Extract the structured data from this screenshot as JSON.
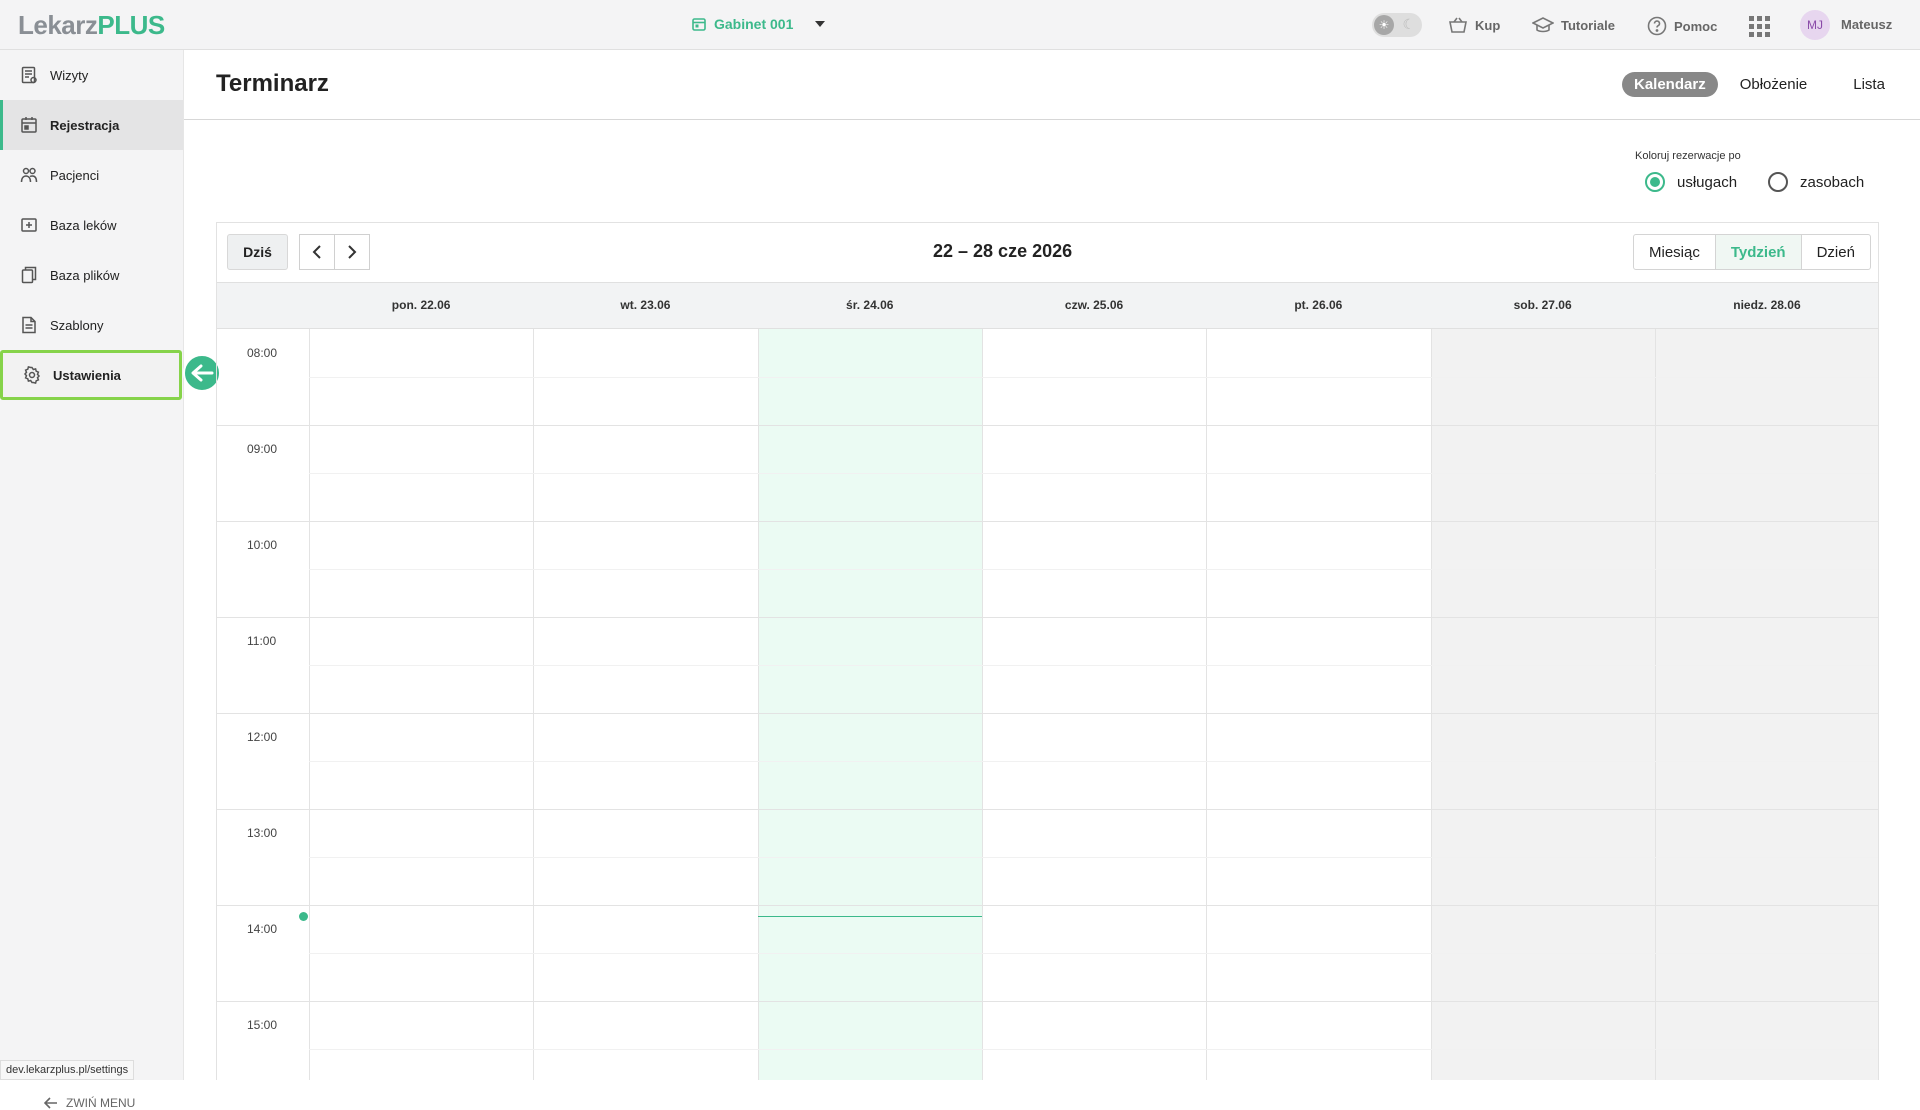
{
  "topbar": {
    "logo_part1": "Lekarz",
    "logo_part2": "PLUS",
    "office": "Gabinet 001",
    "nav": {
      "buy": "Kup",
      "tutorials": "Tutoriale",
      "help": "Pomoc"
    },
    "avatar_initials": "MJ",
    "username": "Mateusz"
  },
  "sidebar": {
    "items": [
      {
        "label": "Wizyty",
        "icon": "visits-icon"
      },
      {
        "label": "Rejestracja",
        "icon": "calendar-icon"
      },
      {
        "label": "Pacjenci",
        "icon": "patients-icon"
      },
      {
        "label": "Baza leków",
        "icon": "medicine-icon"
      },
      {
        "label": "Baza plików",
        "icon": "files-icon"
      },
      {
        "label": "Szablony",
        "icon": "templates-icon"
      },
      {
        "label": "Ustawienia",
        "icon": "gear-icon"
      }
    ],
    "collapse_label": "ZWIŃ MENU"
  },
  "status_url": "dev.lekarzplus.pl/settings",
  "main": {
    "title": "Terminarz",
    "view_tabs": [
      "Kalendarz",
      "Obłożenie",
      "Lista"
    ],
    "active_view_tab": "Kalendarz",
    "color_by": {
      "label": "Koloruj rezerwacje po",
      "options": [
        "usługach",
        "zasobach"
      ],
      "selected": "usługach"
    }
  },
  "calendar": {
    "today_button": "Dziś",
    "range": "22 – 28 cze 2026",
    "modes": [
      "Miesiąc",
      "Tydzień",
      "Dzień"
    ],
    "active_mode": "Tydzień",
    "days": [
      "pon. 22.06",
      "wt. 23.06",
      "śr. 24.06",
      "czw. 25.06",
      "pt. 26.06",
      "sob. 27.06",
      "niedz. 28.06"
    ],
    "today_index": 2,
    "weekend_indices": [
      5,
      6
    ],
    "hours": [
      "08:00",
      "09:00",
      "10:00",
      "11:00",
      "12:00",
      "13:00",
      "14:00",
      "15:00"
    ],
    "current_time_marker": "14:07",
    "colors": {
      "accent": "#3cb98b",
      "today_bg": "#ebfbf3",
      "weekend_bg": "#f2f2f2",
      "highlight_border": "#86d34a"
    }
  }
}
